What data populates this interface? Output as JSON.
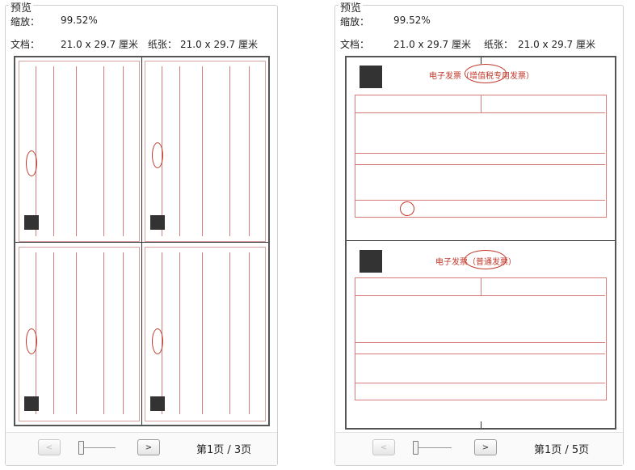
{
  "left": {
    "title": "预览",
    "zoom_label": "缩放：",
    "zoom_value": "99.52%",
    "doc_label": "文档：",
    "doc_value": "21.0 x 29.7 厘米",
    "paper_label": "纸张：",
    "paper_value": "21.0 x 29.7 厘米",
    "prev_label": "<",
    "next_label": ">",
    "page_indicator": "第1页 / 3页",
    "slider_level": 0
  },
  "right": {
    "title": "预览",
    "zoom_label": "缩放：",
    "zoom_value": "99.52%",
    "doc_label": "文档：",
    "doc_value": "21.0 x 29.7 厘米",
    "paper_label": "纸张：",
    "paper_value": "21.0 x 29.7 厘米",
    "prev_label": "<",
    "next_label": ">",
    "page_indicator": "第1页 / 5页",
    "slider_level": 0
  },
  "invoices": {
    "title_a": "电子发票（增值税专用发票）",
    "title_b": "电子发票（普通发票）"
  },
  "colors": {
    "accent_red": "#c0392b",
    "border": "#cfcfcf"
  }
}
